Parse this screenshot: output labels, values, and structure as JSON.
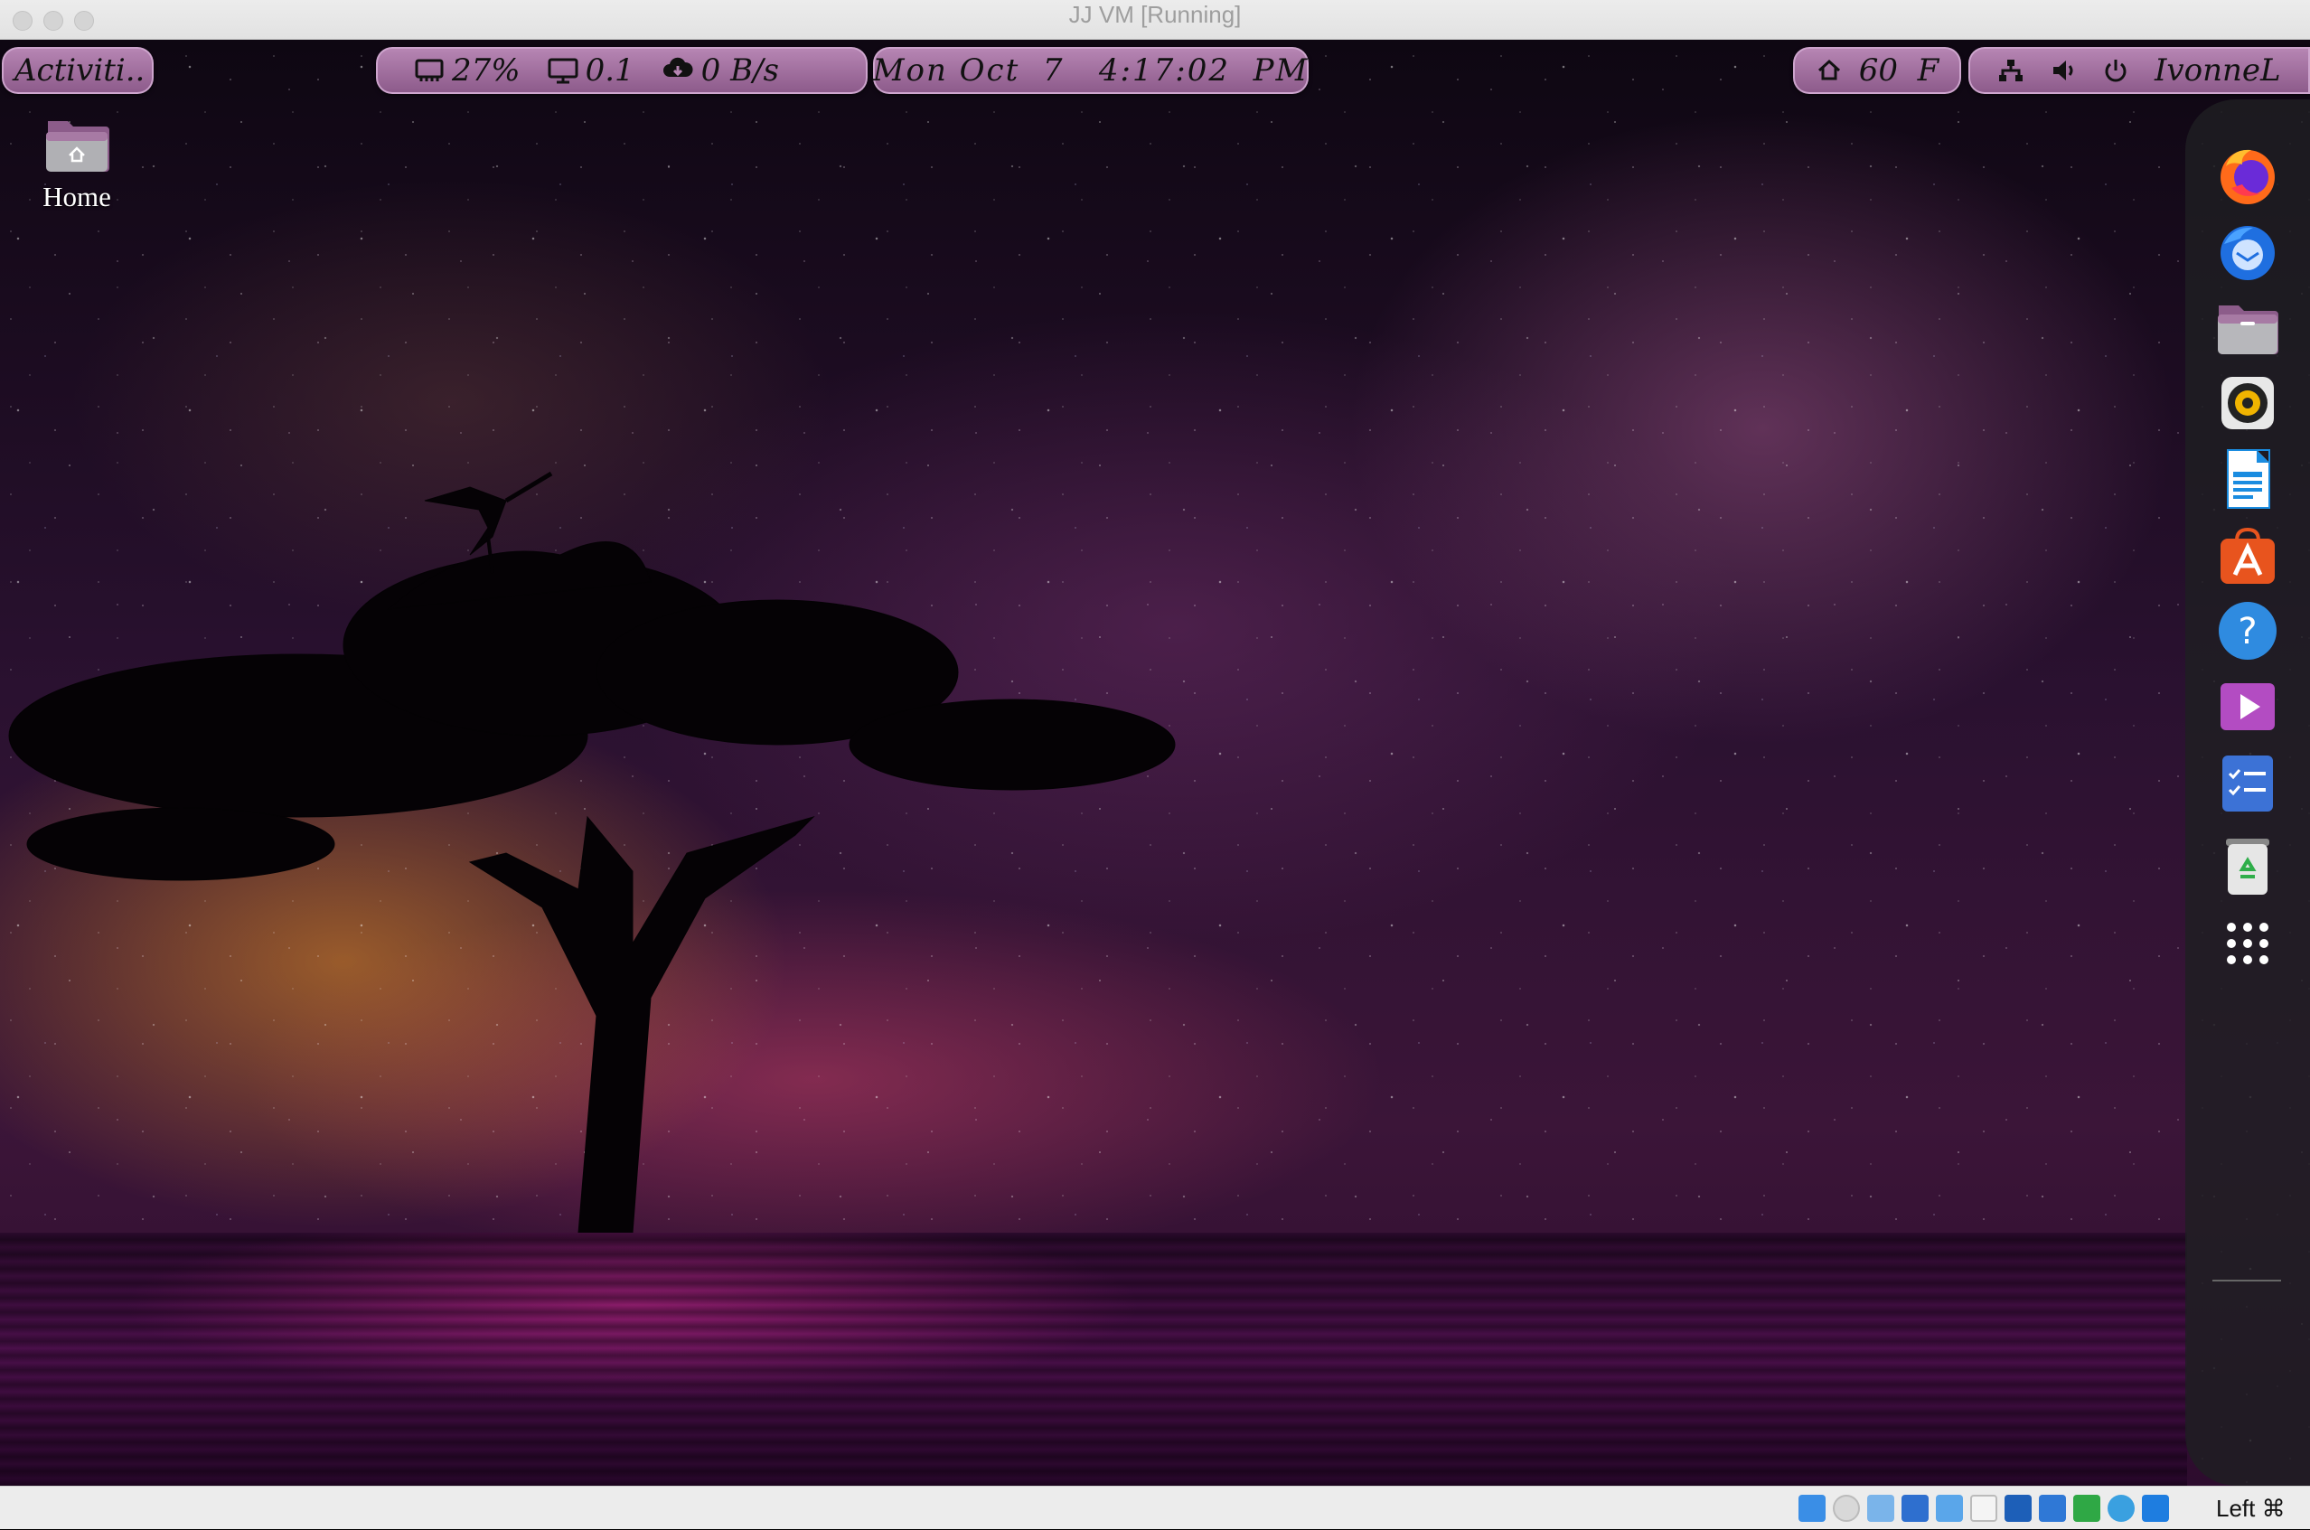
{
  "window": {
    "title": "JJ VM [Running]"
  },
  "top_panel": {
    "activities_label": "Activiti..",
    "cpu": "27%",
    "load": "0.1",
    "network": "0 B/s",
    "clock": "Mon Oct  7   4:17:02  PM",
    "weather": "60  F",
    "user": "IvonneL"
  },
  "desktop": {
    "home_label": "Home"
  },
  "dock": {
    "items": [
      {
        "name": "firefox",
        "icon": "firefox-icon"
      },
      {
        "name": "thunderbird",
        "icon": "thunderbird-icon"
      },
      {
        "name": "files",
        "icon": "folder-icon"
      },
      {
        "name": "rhythmbox",
        "icon": "speaker-icon"
      },
      {
        "name": "libreoffice-writer",
        "icon": "document-icon"
      },
      {
        "name": "app-center",
        "icon": "store-icon"
      },
      {
        "name": "help",
        "icon": "help-icon"
      },
      {
        "name": "video-player",
        "icon": "play-icon"
      },
      {
        "name": "tasks",
        "icon": "checklist-icon"
      },
      {
        "name": "trash",
        "icon": "trash-icon"
      },
      {
        "name": "show-apps",
        "icon": "grid-icon"
      }
    ]
  },
  "statusbar": {
    "host_key": "Left ⌘",
    "icons": [
      "disk-icon",
      "optical-icon",
      "audio-icon",
      "network-icon",
      "usb-icon",
      "shared-folder-icon",
      "display-icon",
      "capture-icon",
      "cpu-icon",
      "mouse-integration-icon",
      "download-icon"
    ]
  },
  "colors": {
    "panel_pill": "#a474a1",
    "dock_bg": "#1e1e22",
    "status_bar": "#ececec"
  }
}
